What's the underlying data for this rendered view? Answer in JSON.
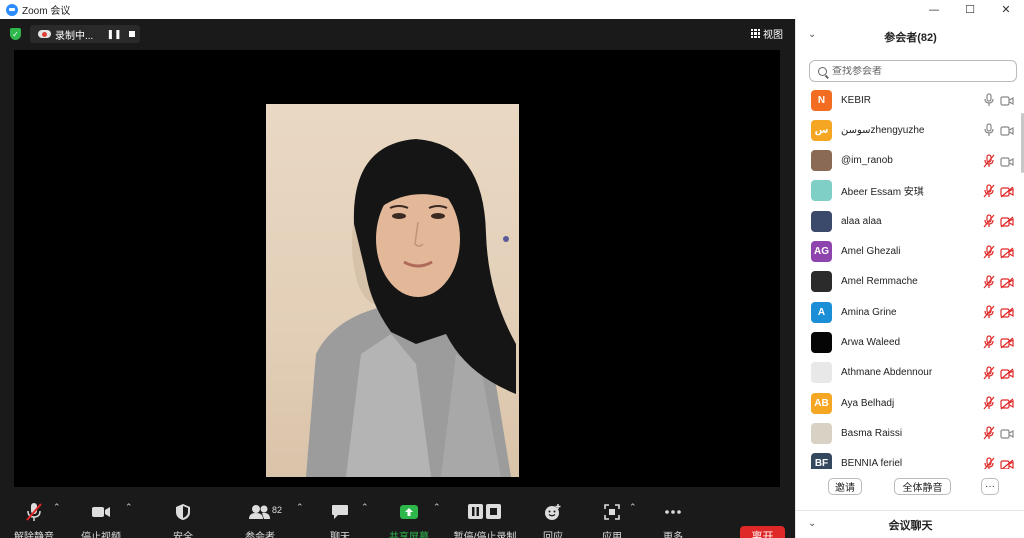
{
  "window": {
    "title": "Zoom 会议",
    "minimize": "—",
    "maximize": "☐",
    "close": "✕"
  },
  "recording": {
    "label": "录制中...",
    "pause": "❚❚"
  },
  "view_label": "视图",
  "toolbar": {
    "unmute": "解除静音",
    "stop_video": "停止视频",
    "security": "安全",
    "participants": "参会者",
    "participants_count": "82",
    "chat": "聊天",
    "share": "共享屏幕",
    "record": "暂停/停止录制",
    "reactions": "回应",
    "apps": "应用",
    "more": "更多",
    "leave": "离开"
  },
  "panel": {
    "title": "参会者(82)",
    "search_placeholder": "查找参会者",
    "participants": [
      {
        "name": "KEBIR",
        "initials": "N",
        "color": "#f26d21",
        "mic": "on",
        "cam": "on"
      },
      {
        "name": "سوسنzhengyuzhe",
        "initials": "س",
        "color": "#f5a623",
        "mic": "on",
        "cam": "on"
      },
      {
        "name": "@im_ranob",
        "initials": "",
        "color": "#8a6a55",
        "mic": "off",
        "cam": "on"
      },
      {
        "name": "Abeer Essam 安琪",
        "initials": "",
        "color": "#7fcfc6",
        "mic": "off",
        "cam": "off"
      },
      {
        "name": "alaa alaa",
        "initials": "",
        "color": "#3b4a6b",
        "mic": "off",
        "cam": "off"
      },
      {
        "name": "Amel Ghezali",
        "initials": "AG",
        "color": "#8e44ad",
        "mic": "off",
        "cam": "off"
      },
      {
        "name": "Amel Remmache",
        "initials": "",
        "color": "#2b2b2b",
        "mic": "off",
        "cam": "off"
      },
      {
        "name": "Amina Grine",
        "initials": "A",
        "color": "#1a8fd8",
        "mic": "off",
        "cam": "off"
      },
      {
        "name": "Arwa Waleed",
        "initials": "",
        "color": "#050505",
        "mic": "off",
        "cam": "off"
      },
      {
        "name": "Athmane Abdennour",
        "initials": "",
        "color": "#e8e8e8",
        "mic": "off",
        "cam": "off"
      },
      {
        "name": "Aya Belhadj",
        "initials": "AB",
        "color": "#f5a623",
        "mic": "off",
        "cam": "off"
      },
      {
        "name": "Basma Raissi",
        "initials": "",
        "color": "#d8d2c4",
        "mic": "off",
        "cam": "on"
      },
      {
        "name": "BENNIA feriel",
        "initials": "BF",
        "color": "#34495e",
        "mic": "off",
        "cam": "off"
      }
    ],
    "invite": "邀请",
    "mute_all": "全体静音",
    "more": "···",
    "chat_title": "会议聊天"
  }
}
